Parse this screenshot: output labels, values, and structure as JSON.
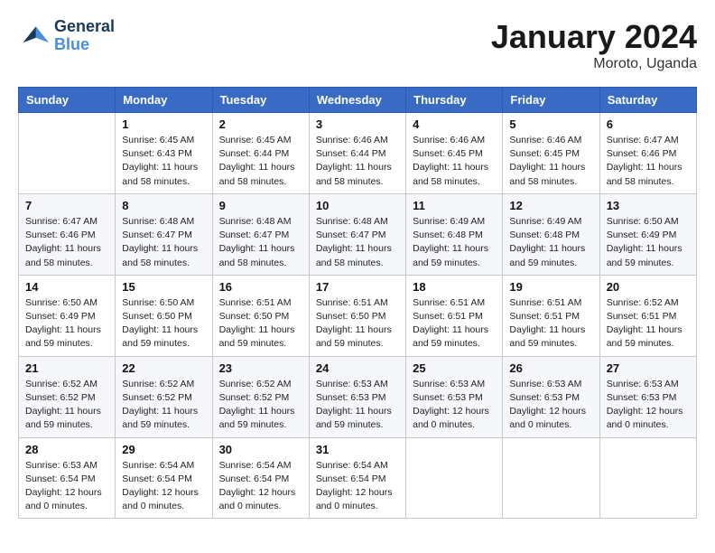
{
  "header": {
    "logo_line1": "General",
    "logo_line2": "Blue",
    "month": "January 2024",
    "location": "Moroto, Uganda"
  },
  "weekdays": [
    "Sunday",
    "Monday",
    "Tuesday",
    "Wednesday",
    "Thursday",
    "Friday",
    "Saturday"
  ],
  "weeks": [
    [
      {
        "day": "",
        "info": ""
      },
      {
        "day": "1",
        "info": "Sunrise: 6:45 AM\nSunset: 6:43 PM\nDaylight: 11 hours and 58 minutes."
      },
      {
        "day": "2",
        "info": "Sunrise: 6:45 AM\nSunset: 6:44 PM\nDaylight: 11 hours and 58 minutes."
      },
      {
        "day": "3",
        "info": "Sunrise: 6:46 AM\nSunset: 6:44 PM\nDaylight: 11 hours and 58 minutes."
      },
      {
        "day": "4",
        "info": "Sunrise: 6:46 AM\nSunset: 6:45 PM\nDaylight: 11 hours and 58 minutes."
      },
      {
        "day": "5",
        "info": "Sunrise: 6:46 AM\nSunset: 6:45 PM\nDaylight: 11 hours and 58 minutes."
      },
      {
        "day": "6",
        "info": "Sunrise: 6:47 AM\nSunset: 6:46 PM\nDaylight: 11 hours and 58 minutes."
      }
    ],
    [
      {
        "day": "7",
        "info": "Sunrise: 6:47 AM\nSunset: 6:46 PM\nDaylight: 11 hours and 58 minutes."
      },
      {
        "day": "8",
        "info": "Sunrise: 6:48 AM\nSunset: 6:47 PM\nDaylight: 11 hours and 58 minutes."
      },
      {
        "day": "9",
        "info": "Sunrise: 6:48 AM\nSunset: 6:47 PM\nDaylight: 11 hours and 58 minutes."
      },
      {
        "day": "10",
        "info": "Sunrise: 6:48 AM\nSunset: 6:47 PM\nDaylight: 11 hours and 58 minutes."
      },
      {
        "day": "11",
        "info": "Sunrise: 6:49 AM\nSunset: 6:48 PM\nDaylight: 11 hours and 59 minutes."
      },
      {
        "day": "12",
        "info": "Sunrise: 6:49 AM\nSunset: 6:48 PM\nDaylight: 11 hours and 59 minutes."
      },
      {
        "day": "13",
        "info": "Sunrise: 6:50 AM\nSunset: 6:49 PM\nDaylight: 11 hours and 59 minutes."
      }
    ],
    [
      {
        "day": "14",
        "info": "Sunrise: 6:50 AM\nSunset: 6:49 PM\nDaylight: 11 hours and 59 minutes."
      },
      {
        "day": "15",
        "info": "Sunrise: 6:50 AM\nSunset: 6:50 PM\nDaylight: 11 hours and 59 minutes."
      },
      {
        "day": "16",
        "info": "Sunrise: 6:51 AM\nSunset: 6:50 PM\nDaylight: 11 hours and 59 minutes."
      },
      {
        "day": "17",
        "info": "Sunrise: 6:51 AM\nSunset: 6:50 PM\nDaylight: 11 hours and 59 minutes."
      },
      {
        "day": "18",
        "info": "Sunrise: 6:51 AM\nSunset: 6:51 PM\nDaylight: 11 hours and 59 minutes."
      },
      {
        "day": "19",
        "info": "Sunrise: 6:51 AM\nSunset: 6:51 PM\nDaylight: 11 hours and 59 minutes."
      },
      {
        "day": "20",
        "info": "Sunrise: 6:52 AM\nSunset: 6:51 PM\nDaylight: 11 hours and 59 minutes."
      }
    ],
    [
      {
        "day": "21",
        "info": "Sunrise: 6:52 AM\nSunset: 6:52 PM\nDaylight: 11 hours and 59 minutes."
      },
      {
        "day": "22",
        "info": "Sunrise: 6:52 AM\nSunset: 6:52 PM\nDaylight: 11 hours and 59 minutes."
      },
      {
        "day": "23",
        "info": "Sunrise: 6:52 AM\nSunset: 6:52 PM\nDaylight: 11 hours and 59 minutes."
      },
      {
        "day": "24",
        "info": "Sunrise: 6:53 AM\nSunset: 6:53 PM\nDaylight: 11 hours and 59 minutes."
      },
      {
        "day": "25",
        "info": "Sunrise: 6:53 AM\nSunset: 6:53 PM\nDaylight: 12 hours and 0 minutes."
      },
      {
        "day": "26",
        "info": "Sunrise: 6:53 AM\nSunset: 6:53 PM\nDaylight: 12 hours and 0 minutes."
      },
      {
        "day": "27",
        "info": "Sunrise: 6:53 AM\nSunset: 6:53 PM\nDaylight: 12 hours and 0 minutes."
      }
    ],
    [
      {
        "day": "28",
        "info": "Sunrise: 6:53 AM\nSunset: 6:54 PM\nDaylight: 12 hours and 0 minutes."
      },
      {
        "day": "29",
        "info": "Sunrise: 6:54 AM\nSunset: 6:54 PM\nDaylight: 12 hours and 0 minutes."
      },
      {
        "day": "30",
        "info": "Sunrise: 6:54 AM\nSunset: 6:54 PM\nDaylight: 12 hours and 0 minutes."
      },
      {
        "day": "31",
        "info": "Sunrise: 6:54 AM\nSunset: 6:54 PM\nDaylight: 12 hours and 0 minutes."
      },
      {
        "day": "",
        "info": ""
      },
      {
        "day": "",
        "info": ""
      },
      {
        "day": "",
        "info": ""
      }
    ]
  ]
}
